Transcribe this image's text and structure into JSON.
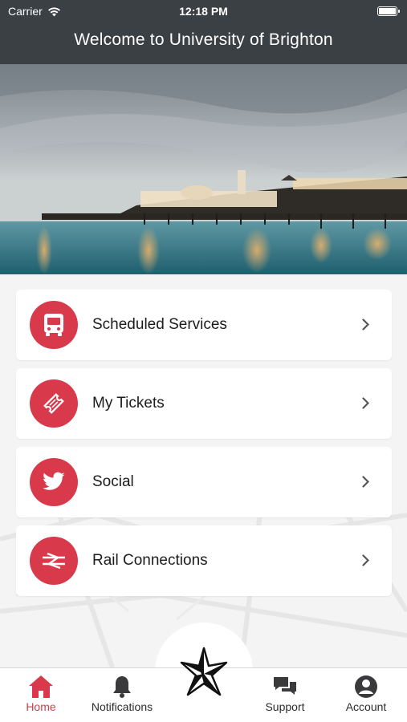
{
  "status_bar": {
    "carrier": "Carrier",
    "time": "12:18 PM"
  },
  "header": {
    "title": "Welcome to University of Brighton"
  },
  "colors": {
    "accent": "#d93a4b",
    "header_bg": "#3b4045"
  },
  "menu": [
    {
      "label": "Scheduled Services",
      "icon": "bus-icon"
    },
    {
      "label": "My Tickets",
      "icon": "ticket-icon"
    },
    {
      "label": "Social",
      "icon": "twitter-bird-icon"
    },
    {
      "label": "Rail Connections",
      "icon": "national-rail-icon"
    }
  ],
  "tabbar": {
    "home": "Home",
    "notifications": "Notifications",
    "support": "Support",
    "account": "Account",
    "center_icon": "compass-star-icon"
  }
}
